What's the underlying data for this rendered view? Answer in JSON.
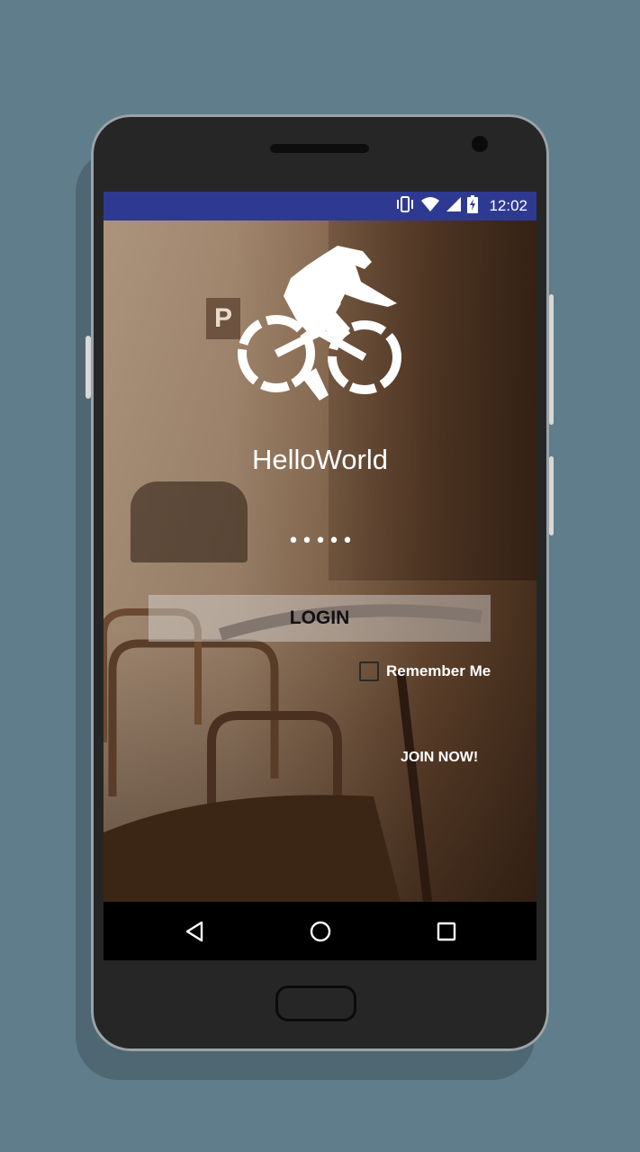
{
  "status_bar": {
    "time": "12:02",
    "icons": [
      "vibrate-icon",
      "wifi-icon",
      "signal-icon",
      "battery-charging-icon"
    ],
    "background_color": "#2E3A92"
  },
  "app": {
    "title": "HelloWorld",
    "logo": "cyclist-icon"
  },
  "form": {
    "password_value": "•••••",
    "login_label": "LOGIN",
    "remember_label": "Remember Me",
    "remember_checked": false,
    "join_label": "JOIN NOW!"
  },
  "nav_bar": {
    "buttons": [
      "back-icon",
      "home-icon",
      "recents-icon"
    ]
  },
  "colors": {
    "page_background": "#607D8B",
    "phone_body": "#262626"
  }
}
